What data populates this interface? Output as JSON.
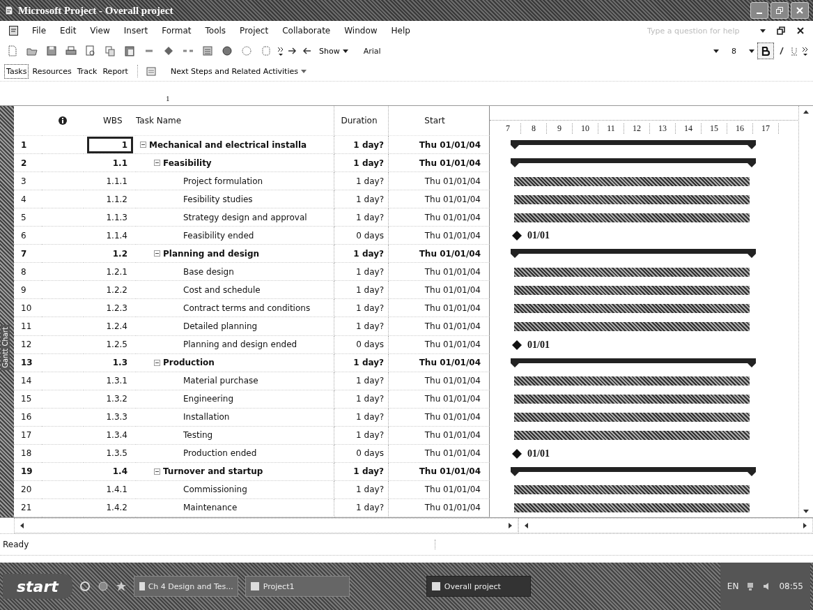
{
  "window": {
    "title": "Microsoft Project - Overall project"
  },
  "menu": [
    "File",
    "Edit",
    "View",
    "Insert",
    "Format",
    "Tools",
    "Project",
    "Collaborate",
    "Window",
    "Help"
  ],
  "help_search": {
    "placeholder": "Type a question for help"
  },
  "formatting": {
    "show": "Show",
    "font": "Arial",
    "size": "8",
    "bold": true
  },
  "view_tabs": [
    {
      "label": "Tasks",
      "selected": true
    },
    {
      "label": "Resources",
      "selected": false
    },
    {
      "label": "Track",
      "selected": false
    },
    {
      "label": "Report",
      "selected": false
    }
  ],
  "guide": {
    "label": "Next Steps and Related Activities"
  },
  "entry_bar": {
    "value": "1"
  },
  "side_label": "Gantt Chart",
  "table": {
    "columns": [
      "WBS",
      "Task Name",
      "Duration",
      "Start"
    ],
    "tasks": [
      {
        "id": "1",
        "wbs": "1",
        "name": "Mechanical and electrical installa",
        "duration": "1 day?",
        "start": "Thu 01/01/04",
        "kind": "summary",
        "expanded": true,
        "selected": true,
        "children": [
          {
            "id": "2",
            "wbs": "1.1",
            "name": "Feasibility",
            "duration": "1 day?",
            "start": "Thu 01/01/04",
            "kind": "summary",
            "expanded": true,
            "selected": false,
            "children": [
              {
                "id": "3",
                "wbs": "1.1.1",
                "name": "Project formulation",
                "duration": "1 day?",
                "start": "Thu 01/01/04",
                "kind": "task",
                "selected": false
              },
              {
                "id": "4",
                "wbs": "1.1.2",
                "name": "Fesibility studies",
                "duration": "1 day?",
                "start": "Thu 01/01/04",
                "kind": "task",
                "selected": false
              },
              {
                "id": "5",
                "wbs": "1.1.3",
                "name": "Strategy design and approval",
                "duration": "1 day?",
                "start": "Thu 01/01/04",
                "kind": "task",
                "selected": false
              },
              {
                "id": "6",
                "wbs": "1.1.4",
                "name": "Feasibility ended",
                "duration": "0 days",
                "start": "Thu 01/01/04",
                "kind": "milestone",
                "bar_label": "01/01",
                "selected": false
              }
            ]
          },
          {
            "id": "7",
            "wbs": "1.2",
            "name": "Planning and design",
            "duration": "1 day?",
            "start": "Thu 01/01/04",
            "kind": "summary",
            "expanded": true,
            "selected": false,
            "children": [
              {
                "id": "8",
                "wbs": "1.2.1",
                "name": "Base design",
                "duration": "1 day?",
                "start": "Thu 01/01/04",
                "kind": "task",
                "selected": false
              },
              {
                "id": "9",
                "wbs": "1.2.2",
                "name": "Cost and schedule",
                "duration": "1 day?",
                "start": "Thu 01/01/04",
                "kind": "task",
                "selected": false
              },
              {
                "id": "10",
                "wbs": "1.2.3",
                "name": "Contract terms and conditions",
                "duration": "1 day?",
                "start": "Thu 01/01/04",
                "kind": "task",
                "selected": false
              },
              {
                "id": "11",
                "wbs": "1.2.4",
                "name": "Detailed planning",
                "duration": "1 day?",
                "start": "Thu 01/01/04",
                "kind": "task",
                "selected": false
              },
              {
                "id": "12",
                "wbs": "1.2.5",
                "name": "Planning and design ended",
                "duration": "0 days",
                "start": "Thu 01/01/04",
                "kind": "milestone",
                "bar_label": "01/01",
                "selected": false
              }
            ]
          },
          {
            "id": "13",
            "wbs": "1.3",
            "name": "Production",
            "duration": "1 day?",
            "start": "Thu 01/01/04",
            "kind": "summary",
            "expanded": true,
            "selected": false,
            "children": [
              {
                "id": "14",
                "wbs": "1.3.1",
                "name": "Material purchase",
                "duration": "1 day?",
                "start": "Thu 01/01/04",
                "kind": "task",
                "selected": false
              },
              {
                "id": "15",
                "wbs": "1.3.2",
                "name": "Engineering",
                "duration": "1 day?",
                "start": "Thu 01/01/04",
                "kind": "task",
                "selected": false
              },
              {
                "id": "16",
                "wbs": "1.3.3",
                "name": "Installation",
                "duration": "1 day?",
                "start": "Thu 01/01/04",
                "kind": "task",
                "selected": false
              },
              {
                "id": "17",
                "wbs": "1.3.4",
                "name": "Testing",
                "duration": "1 day?",
                "start": "Thu 01/01/04",
                "kind": "task",
                "selected": false
              },
              {
                "id": "18",
                "wbs": "1.3.5",
                "name": "Production ended",
                "duration": "0 days",
                "start": "Thu 01/01/04",
                "kind": "milestone",
                "bar_label": "01/01",
                "selected": false
              }
            ]
          },
          {
            "id": "19",
            "wbs": "1.4",
            "name": "Turnover and startup",
            "duration": "1 day?",
            "start": "Thu 01/01/04",
            "kind": "summary",
            "expanded": true,
            "selected": false,
            "children": [
              {
                "id": "20",
                "wbs": "1.4.1",
                "name": "Commissioning",
                "duration": "1 day?",
                "start": "Thu 01/01/04",
                "kind": "task",
                "selected": false
              },
              {
                "id": "21",
                "wbs": "1.4.2",
                "name": "Maintenance",
                "duration": "1 day?",
                "start": "Thu 01/01/04",
                "kind": "task",
                "selected": false
              }
            ]
          }
        ]
      }
    ]
  },
  "timescale": [
    "7",
    "8",
    "9",
    "10",
    "11",
    "12",
    "13",
    "14",
    "15",
    "16",
    "17"
  ],
  "status_bar": {
    "text": "Ready"
  },
  "taskbar": {
    "start": "start",
    "items": [
      {
        "label": "Ch 4 Design and Tes...",
        "selected": false
      },
      {
        "label": "Project1",
        "selected": false
      },
      {
        "label": "Overall project",
        "selected": true
      }
    ],
    "language": "EN",
    "clock": "08:55"
  }
}
